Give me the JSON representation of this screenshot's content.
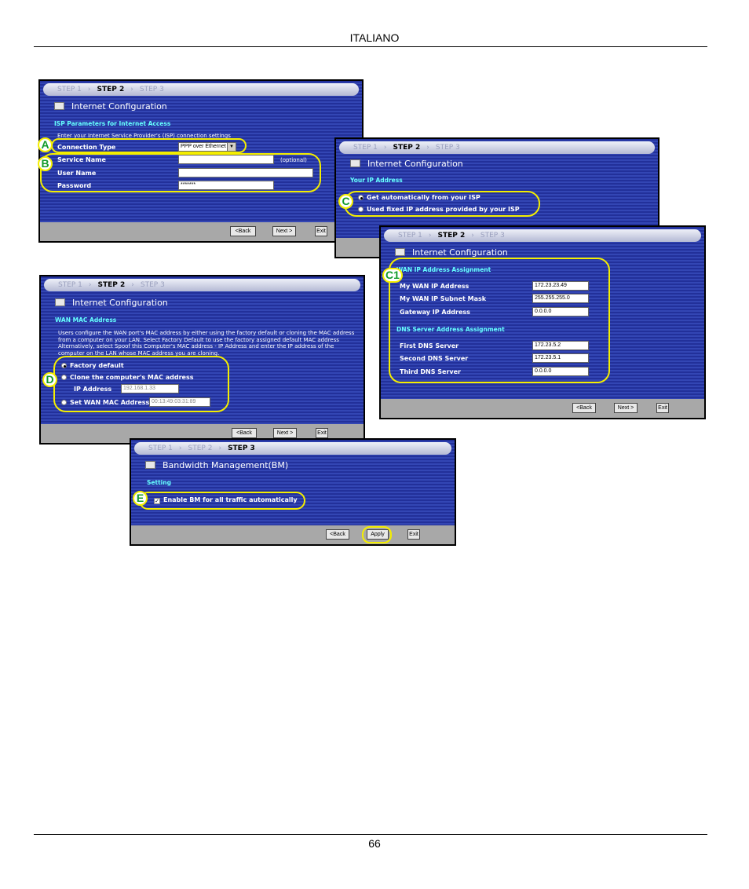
{
  "page": {
    "header": "ITALIANO",
    "page_number": "66"
  },
  "step_bar": {
    "step1": "STEP 1",
    "step2": "STEP 2",
    "step3": "STEP 3"
  },
  "buttons": {
    "back": "<Back",
    "next": "Next >",
    "exit": "Exit",
    "apply": "Apply"
  },
  "win_isp": {
    "title": "Internet Configuration",
    "section": "ISP Parameters for Internet Access",
    "intro": "Enter your Internet Service Provider's (ISP) connection settings",
    "connection_type_label": "Connection Type",
    "connection_type_value": "PPP over Ethernet",
    "service_name_label": "Service Name",
    "optional": "(optional)",
    "user_name_label": "User Name",
    "password_label": "Password",
    "password_value": "*******"
  },
  "win_ip": {
    "title": "Internet Configuration",
    "section": "Your IP Address",
    "option_auto": "Get automatically from your ISP",
    "option_fixed": "Used fixed IP address provided by your ISP"
  },
  "win_wan": {
    "title": "Internet Configuration",
    "section": "WAN IP Address Assignment",
    "my_wan_ip_label": "My WAN IP Address",
    "my_wan_ip": "172.23.23.49",
    "subnet_label": "My WAN IP Subnet Mask",
    "subnet": "255.255.255.0",
    "gateway_label": "Gateway IP Address",
    "gateway": "0.0.0.0",
    "dns_section": "DNS Server Address Assignment",
    "dns1_label": "First DNS Server",
    "dns1": "172.23.5.2",
    "dns2_label": "Second DNS Server",
    "dns2": "172.23.5.1",
    "dns3_label": "Third DNS Server",
    "dns3": "0.0.0.0"
  },
  "win_mac": {
    "title": "Internet Configuration",
    "section": "WAN MAC Address",
    "intro": "Users configure the WAN port's MAC address by either using the factory default or cloning the MAC address from a computer on your LAN. Select Factory Default to use the factory assigned default MAC address Alternatively, select Spoof this Computer's MAC address - IP Address and enter the IP address of the computer on the LAN whose MAC address you are cloning.",
    "factory_default": "Factory default",
    "clone": "Clone the computer's MAC address",
    "ip_label": "IP Address",
    "ip_value": "192.168.1.33",
    "set_wan": "Set WAN MAC Address",
    "mac_value": "00:13:49:03:31:89"
  },
  "win_bm": {
    "title": "Bandwidth Management(BM)",
    "section": "Setting",
    "enable": "Enable BM for all traffic automatically"
  },
  "callouts": {
    "A": "A",
    "B": "B",
    "C": "C",
    "C1": "C1",
    "D": "D",
    "E": "E"
  },
  "colors": {
    "window_bg": "#22309a",
    "section_text": "#66ffff",
    "callout": "#f4ee00",
    "badge_letter": "#129b2a"
  }
}
